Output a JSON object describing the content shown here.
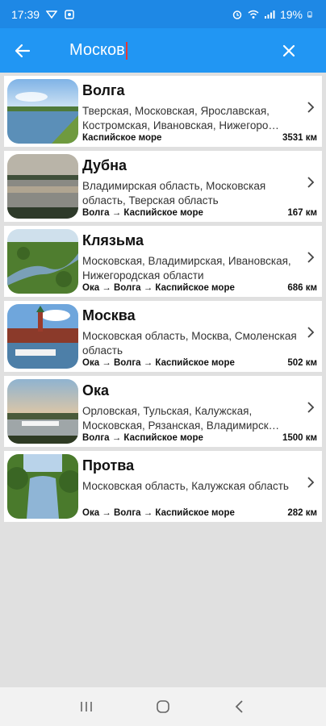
{
  "status": {
    "time": "17:39",
    "battery": "19%"
  },
  "search": {
    "query": "Москов"
  },
  "rivers": [
    {
      "name": "Волга",
      "regions": "Тверская, Московская, Ярославская, Костромская, Ивановская, Нижегоро…",
      "route": "Каспийское море",
      "length": "3531 км"
    },
    {
      "name": "Дубна",
      "regions": "Владимирская область, Московская область, Тверская область",
      "route": "Волга → Каспийское море",
      "length": "167 км"
    },
    {
      "name": "Клязьма",
      "regions": "Московская, Владимирская, Ивановская, Нижегородская области",
      "route": "Ока → Волга → Каспийское море",
      "length": "686 км"
    },
    {
      "name": "Москва",
      "regions": "Московская область, Москва, Смоленская область",
      "route": "Ока → Волга → Каспийское море",
      "length": "502 км"
    },
    {
      "name": "Ока",
      "regions": "Орловская, Тульская, Калужская, Московская, Рязанская, Владимирск…",
      "route": "Волга → Каспийское море",
      "length": "1500 км"
    },
    {
      "name": "Протва",
      "regions": "Московская область, Калужская область",
      "route": "Ока → Волга → Каспийское море",
      "length": "282 км"
    }
  ],
  "colors": {
    "status_bar": "#1e88e5",
    "app_bar": "#2196f3",
    "background": "#e0e0e0"
  }
}
